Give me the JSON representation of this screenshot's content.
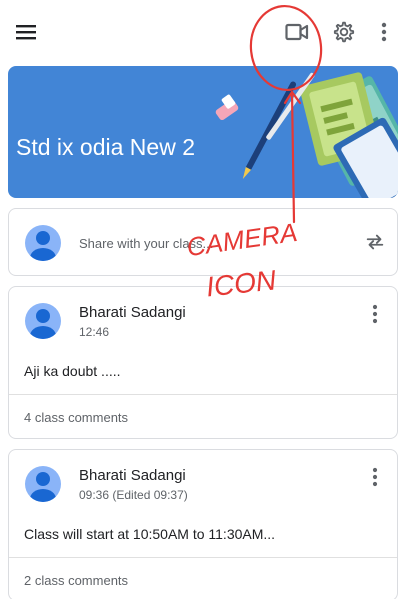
{
  "topbar": {
    "menu_icon": "menu-icon",
    "camera_icon": "video-camera-icon",
    "settings_icon": "gear-icon",
    "more_icon": "more-vert-icon"
  },
  "banner": {
    "title": "Std ix odia New 2",
    "color": "#4285d6"
  },
  "share": {
    "placeholder": "Share with your class...",
    "repost_icon": "repost-icon"
  },
  "posts": [
    {
      "author": "Bharati Sadangi",
      "time": "12:46",
      "text": "Aji ka doubt .....",
      "comments": "4 class comments"
    },
    {
      "author": "Bharati Sadangi",
      "time": "09:36 (Edited 09:37)",
      "text": "Class will start at 10:50AM to 11:30AM...",
      "comments": "2 class comments"
    }
  ],
  "annotation": {
    "line1": "CAMERA",
    "line2": "ICON",
    "color": "#e53935"
  }
}
